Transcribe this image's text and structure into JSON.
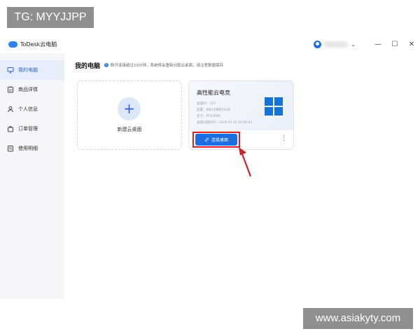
{
  "watermarks": {
    "top": "TG: MYYJJPP",
    "bottom": "www.asiakyty.com"
  },
  "app": {
    "title": "ToDesk云电脑"
  },
  "window_controls": {
    "caret": "⌄",
    "minimize": "—",
    "maximize": "☐",
    "close": "✕"
  },
  "sidebar": {
    "items": [
      {
        "label": "我的电脑",
        "icon": "monitor-icon",
        "active": true
      },
      {
        "label": "商品详情",
        "icon": "clipboard-icon",
        "active": false
      },
      {
        "label": "个人信息",
        "icon": "user-icon",
        "active": false
      },
      {
        "label": "订单管理",
        "icon": "bag-icon",
        "active": false
      },
      {
        "label": "使用明细",
        "icon": "list-icon",
        "active": false
      }
    ]
  },
  "main": {
    "title": "我的电脑",
    "notice_icon": "i",
    "notice": "断开连接超过10分钟，系统将会重新分配云桌面，请注意数据保存",
    "new_card": {
      "plus": "+",
      "label": "新建云桌面"
    },
    "pc_card": {
      "title": "高性能云电竞",
      "specs": [
        "桌面ID：471",
        "配置：8核16线程32GB",
        "显卡：RTX3080",
        "桌面过期时间：2024-03-19 10:00:43"
      ],
      "connect_label": "连接桌面",
      "more": "⋮"
    }
  },
  "colors": {
    "accent": "#1b6fe4",
    "highlight": "#d81f26",
    "sidebar_bg": "#f4f6f9",
    "windows_blue": "#1572d6"
  }
}
